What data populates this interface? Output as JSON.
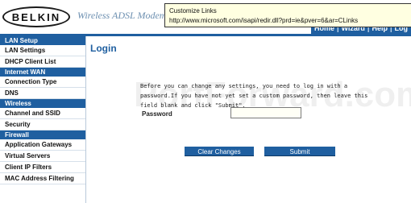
{
  "header": {
    "logo": "BELKIN",
    "product": "Wireless ADSL Modem Ro",
    "nav": [
      "Home",
      "Wizard",
      "Help",
      "Log"
    ]
  },
  "tooltip": {
    "title": "Customize Links",
    "url": "http://www.microsoft.com/isapi/redir.dll?prd=ie&pver=6&ar=CLinks"
  },
  "sidebar": {
    "lan_setup": "LAN Setup",
    "lan_items": [
      "LAN Settings",
      "DHCP Client List"
    ],
    "internet_wan": "Internet WAN",
    "wan_items": [
      "Connection Type",
      "DNS"
    ],
    "wireless": "Wireless",
    "wireless_items": [
      "Channel and SSID",
      "Security"
    ],
    "firewall": "Firewall",
    "firewall_items": [
      "Application Gateways",
      "Virtual Servers",
      "Client IP Filters",
      "MAC Address Filtering"
    ]
  },
  "main": {
    "title": "Login",
    "intro": "Before you can change any settings, you need to log in with a password.If you have not yet set a custom password, then leave this field blank and click \"Submit\".",
    "password_label": "Password",
    "clear_label": "Clear Changes",
    "submit_label": "Submit",
    "watermark": "PortForward.com"
  }
}
